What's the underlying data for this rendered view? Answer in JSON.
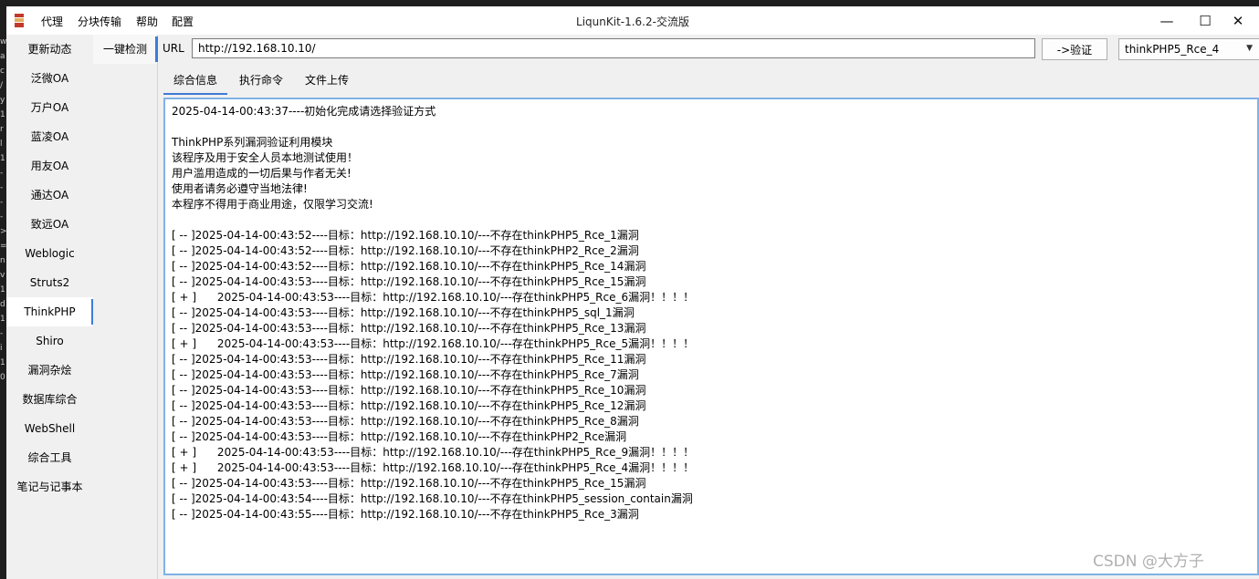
{
  "app": {
    "title": "LiqunKit-1.6.2-交流版",
    "menu": [
      "代理",
      "分块传输",
      "帮助",
      "配置"
    ],
    "window_controls": {
      "minimize": "—",
      "maximize": "☐",
      "close": "✕"
    }
  },
  "sidebar": {
    "items": [
      "更新动态",
      "泛微OA",
      "万户OA",
      "蓝凌OA",
      "用友OA",
      "通达OA",
      "致远OA",
      "Weblogic",
      "Struts2",
      "ThinkPHP",
      "Shiro",
      "漏洞杂烩",
      "数据库综合",
      "WebShell",
      "综合工具",
      "笔记与记事本"
    ],
    "active": "ThinkPHP"
  },
  "subbar": {
    "item": "一键检测"
  },
  "toolbar": {
    "url_label": "URL",
    "url_value": "http://192.168.10.10/",
    "verify_label": "->验证",
    "select_value": "thinkPHP5_Rce_4"
  },
  "tabs": [
    "综合信息",
    "执行命令",
    "文件上传"
  ],
  "active_tab": "综合信息",
  "output": {
    "lines": [
      "2025-04-14-00:43:37----初始化完成请选择验证方式",
      "",
      "ThinkPHP系列漏洞验证利用模块",
      "该程序及用于安全人员本地测试使用！",
      "用户滥用造成的一切后果与作者无关!",
      "使用者请务必遵守当地法律!",
      "本程序不得用于商业用途，仅限学习交流!",
      "",
      "[ -- ]2025-04-14-00:43:52----目标：http://192.168.10.10/---不存在thinkPHP5_Rce_1漏洞",
      "[ -- ]2025-04-14-00:43:52----目标：http://192.168.10.10/---不存在thinkPHP2_Rce_2漏洞",
      "[ -- ]2025-04-14-00:43:52----目标：http://192.168.10.10/---不存在thinkPHP5_Rce_14漏洞",
      "[ -- ]2025-04-14-00:43:53----目标：http://192.168.10.10/---不存在thinkPHP5_Rce_15漏洞",
      "[ + ]      2025-04-14-00:43:53----目标：http://192.168.10.10/---存在thinkPHP5_Rce_6漏洞！！！！",
      "[ -- ]2025-04-14-00:43:53----目标：http://192.168.10.10/---不存在thinkPHP5_sql_1漏洞",
      "[ -- ]2025-04-14-00:43:53----目标：http://192.168.10.10/---不存在thinkPHP5_Rce_13漏洞",
      "[ + ]      2025-04-14-00:43:53----目标：http://192.168.10.10/---存在thinkPHP5_Rce_5漏洞！！！！",
      "[ -- ]2025-04-14-00:43:53----目标：http://192.168.10.10/---不存在thinkPHP5_Rce_11漏洞",
      "[ -- ]2025-04-14-00:43:53----目标：http://192.168.10.10/---不存在thinkPHP5_Rce_7漏洞",
      "[ -- ]2025-04-14-00:43:53----目标：http://192.168.10.10/---不存在thinkPHP5_Rce_10漏洞",
      "[ -- ]2025-04-14-00:43:53----目标：http://192.168.10.10/---不存在thinkPHP5_Rce_12漏洞",
      "[ -- ]2025-04-14-00:43:53----目标：http://192.168.10.10/---不存在thinkPHP5_Rce_8漏洞",
      "[ -- ]2025-04-14-00:43:53----目标：http://192.168.10.10/---不存在thinkPHP2_Rce漏洞",
      "[ + ]      2025-04-14-00:43:53----目标：http://192.168.10.10/---存在thinkPHP5_Rce_9漏洞！！！！",
      "[ + ]      2025-04-14-00:43:53----目标：http://192.168.10.10/---存在thinkPHP5_Rce_4漏洞！！！！",
      "[ -- ]2025-04-14-00:43:53----目标：http://192.168.10.10/---不存在thinkPHP5_Rce_15漏洞",
      "[ -- ]2025-04-14-00:43:54----目标：http://192.168.10.10/---不存在thinkPHP5_session_contain漏洞",
      "[ -- ]2025-04-14-00:43:55----目标：http://192.168.10.10/---不存在thinkPHP5_Rce_3漏洞"
    ]
  },
  "watermark": "CSDN @大方子",
  "background_glyphs": [
    "w",
    "a",
    "c",
    "/",
    "y",
    "1",
    "r",
    "l",
    "1",
    "-",
    "-",
    "-",
    "-",
    ">",
    "=",
    "n",
    "v",
    "1",
    "d",
    "1",
    "-",
    "i",
    "1",
    "0"
  ]
}
